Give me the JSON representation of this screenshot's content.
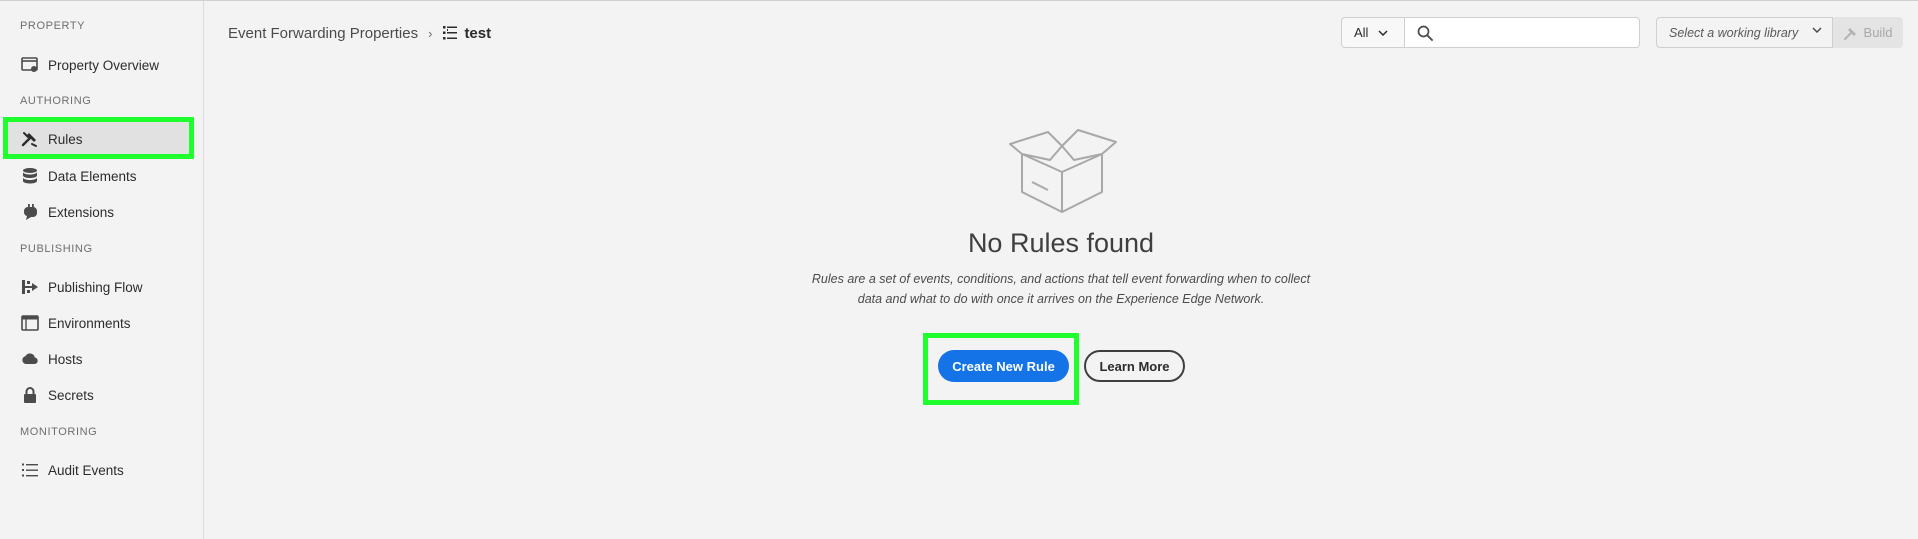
{
  "sidebar": {
    "sections": [
      {
        "header": "PROPERTY",
        "items": [
          {
            "label": "Property Overview",
            "icon": "property-overview-icon"
          }
        ]
      },
      {
        "header": "AUTHORING",
        "items": [
          {
            "label": "Rules",
            "icon": "rules-icon",
            "selected": true
          },
          {
            "label": "Data Elements",
            "icon": "data-elements-icon"
          },
          {
            "label": "Extensions",
            "icon": "extensions-icon"
          }
        ]
      },
      {
        "header": "PUBLISHING",
        "items": [
          {
            "label": "Publishing Flow",
            "icon": "publishing-flow-icon"
          },
          {
            "label": "Environments",
            "icon": "environments-icon"
          },
          {
            "label": "Hosts",
            "icon": "cloud-icon"
          },
          {
            "label": "Secrets",
            "icon": "lock-icon"
          }
        ]
      },
      {
        "header": "MONITORING",
        "items": [
          {
            "label": "Audit Events",
            "icon": "list-icon"
          }
        ]
      }
    ]
  },
  "breadcrumb": {
    "parent": "Event Forwarding Properties",
    "current": "test"
  },
  "toolbar": {
    "filter_value": "All",
    "search_placeholder": "",
    "library_placeholder": "Select a working library",
    "build_label": "Build"
  },
  "empty_state": {
    "title": "No Rules found",
    "description_line1": "Rules are a set of events, conditions, and actions that tell event forwarding when to collect",
    "description_line2": "data and what to do with once it arrives on the Experience Edge Network.",
    "primary_button": "Create New Rule",
    "secondary_button": "Learn More"
  },
  "colors": {
    "accent": "#1473e6",
    "highlight": "#20ff2e",
    "background": "#f3f3f3"
  }
}
